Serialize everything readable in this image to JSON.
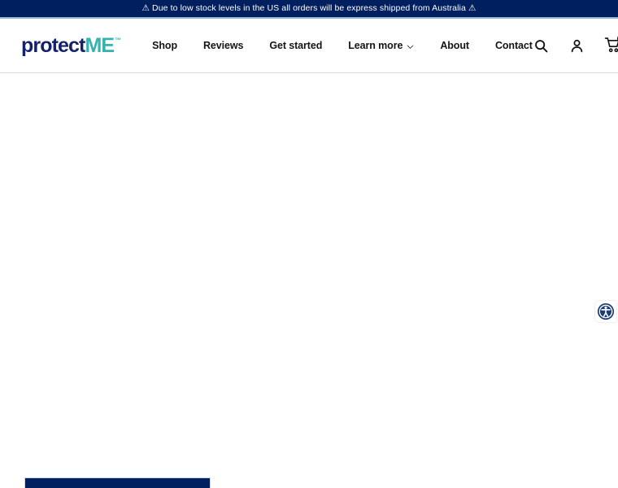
{
  "announcement": {
    "text": "⚠ Due to low stock levels in the US all orders will be express shipped from Australia ⚠",
    "background_color": "#001f5f",
    "text_color": "#ffffff"
  },
  "header": {
    "logo": {
      "primary_text": "protect",
      "accent_text": "ME",
      "trademark": "™",
      "primary_color": "#16216b",
      "accent_color": "#35b3ae"
    },
    "nav_items": [
      {
        "label": "Shop",
        "has_dropdown": false
      },
      {
        "label": "Reviews",
        "has_dropdown": false
      },
      {
        "label": "Get started",
        "has_dropdown": false
      },
      {
        "label": "Learn more",
        "has_dropdown": true,
        "icon": "chevron-down-icon"
      },
      {
        "label": "About",
        "has_dropdown": false
      },
      {
        "label": "Contact",
        "has_dropdown": false
      }
    ],
    "actions": [
      {
        "name": "search-icon",
        "label": "Search"
      },
      {
        "name": "account-icon",
        "label": "Account"
      },
      {
        "name": "cart-icon",
        "label": "Cart"
      }
    ],
    "cart": {
      "count": "0"
    }
  },
  "main": {
    "state": "loading",
    "content": ""
  },
  "cta": {
    "label": "",
    "background_color": "#001f5f"
  },
  "accessibility": {
    "label": "Accessibility Menu",
    "icon": "accessibility-icon",
    "color": "#1c3c78"
  }
}
